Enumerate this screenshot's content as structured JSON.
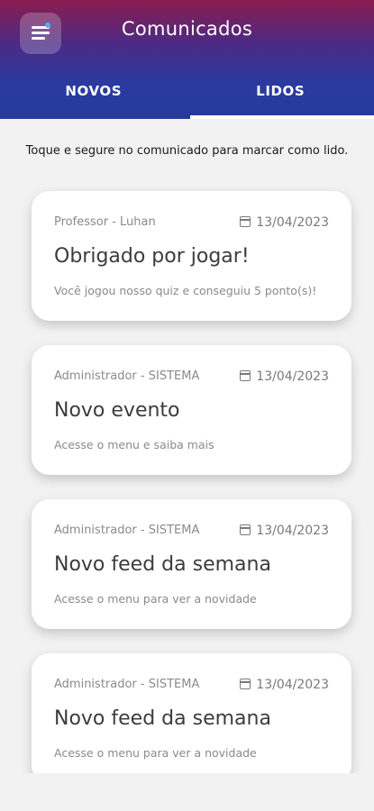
{
  "header": {
    "title": "Comunicados",
    "menu_icon": "menu-icon"
  },
  "tabs": [
    {
      "label": "NOVOS",
      "active": false
    },
    {
      "label": "LIDOS",
      "active": true
    }
  ],
  "hint": "Toque e segure no comunicado para marcar como lido.",
  "cards": [
    {
      "author": "Professor - Luhan",
      "date": "13/04/2023",
      "title": "Obrigado por jogar!",
      "subtitle": "Você jogou nosso quiz e conseguiu 5 ponto(s)!"
    },
    {
      "author": "Administrador - SISTEMA",
      "date": "13/04/2023",
      "title": "Novo evento",
      "subtitle": "Acesse o menu e saiba mais"
    },
    {
      "author": "Administrador - SISTEMA",
      "date": "13/04/2023",
      "title": "Novo feed da semana",
      "subtitle": "Acesse o menu para ver a novidade"
    },
    {
      "author": "Administrador - SISTEMA",
      "date": "13/04/2023",
      "title": "Novo feed da semana",
      "subtitle": "Acesse o menu para ver a novidade"
    }
  ],
  "colors": {
    "header_gradient_top": "#8a1c4e",
    "header_gradient_bottom": "#253a9c",
    "background": "#f2f2f2"
  }
}
